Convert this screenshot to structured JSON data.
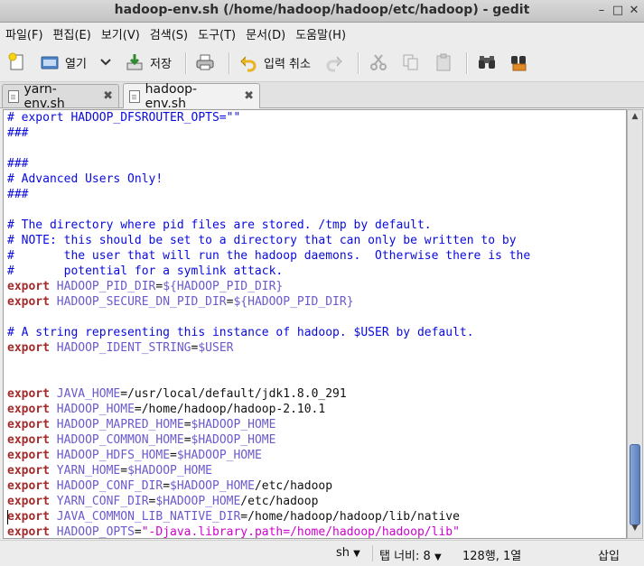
{
  "window": {
    "title": "hadoop-env.sh (/home/hadoop/hadoop/etc/hadoop) - gedit",
    "controls": {
      "minimize": "–",
      "maximize": "□",
      "close": "✕"
    }
  },
  "menu": {
    "items": [
      "파일(F)",
      "편집(E)",
      "보기(V)",
      "검색(S)",
      "도구(T)",
      "문서(D)",
      "도움말(H)"
    ]
  },
  "toolbar": {
    "open_label": "열기",
    "save_label": "저장",
    "undo_label": "입력 취소"
  },
  "tabs": [
    {
      "label": "yarn-env.sh",
      "close": "✖"
    },
    {
      "label": "hadoop-env.sh",
      "close": "✖"
    }
  ],
  "editor": {
    "lines": [
      [
        [
          "cm",
          "# export HADOOP_DFSROUTER_OPTS=\"\""
        ]
      ],
      [
        [
          "cm",
          "###"
        ]
      ],
      [
        [
          "tx",
          ""
        ]
      ],
      [
        [
          "cm",
          "###"
        ]
      ],
      [
        [
          "cm",
          "# Advanced Users Only!"
        ]
      ],
      [
        [
          "cm",
          "###"
        ]
      ],
      [
        [
          "tx",
          ""
        ]
      ],
      [
        [
          "cm",
          "# The directory where pid files are stored. /tmp by default."
        ]
      ],
      [
        [
          "cm",
          "# NOTE: this should be set to a directory that can only be written to by"
        ]
      ],
      [
        [
          "cm",
          "#       the user that will run the hadoop daemons.  Otherwise there is the"
        ]
      ],
      [
        [
          "cm",
          "#       potential for a symlink attack."
        ]
      ],
      [
        [
          "kw",
          "export"
        ],
        [
          "tx",
          " "
        ],
        [
          "vn",
          "HADOOP_PID_DIR"
        ],
        [
          "tx",
          "="
        ],
        [
          "vn",
          "${HADOOP_PID_DIR}"
        ]
      ],
      [
        [
          "kw",
          "export"
        ],
        [
          "tx",
          " "
        ],
        [
          "vn",
          "HADOOP_SECURE_DN_PID_DIR"
        ],
        [
          "tx",
          "="
        ],
        [
          "vn",
          "${HADOOP_PID_DIR}"
        ]
      ],
      [
        [
          "tx",
          ""
        ]
      ],
      [
        [
          "cm",
          "# A string representing this instance of hadoop. $USER by default."
        ]
      ],
      [
        [
          "kw",
          "export"
        ],
        [
          "tx",
          " "
        ],
        [
          "vn",
          "HADOOP_IDENT_STRING"
        ],
        [
          "tx",
          "="
        ],
        [
          "vn",
          "$USER"
        ]
      ],
      [
        [
          "tx",
          ""
        ]
      ],
      [
        [
          "tx",
          ""
        ]
      ],
      [
        [
          "kw",
          "export"
        ],
        [
          "tx",
          " "
        ],
        [
          "vn",
          "JAVA_HOME"
        ],
        [
          "tx",
          "=/usr/local/default/jdk1.8.0_291"
        ]
      ],
      [
        [
          "kw",
          "export"
        ],
        [
          "tx",
          " "
        ],
        [
          "vn",
          "HADOOP_HOME"
        ],
        [
          "tx",
          "=/home/hadoop/hadoop-2.10.1"
        ]
      ],
      [
        [
          "kw",
          "export"
        ],
        [
          "tx",
          " "
        ],
        [
          "vn",
          "HADOOP_MAPRED_HOME"
        ],
        [
          "tx",
          "="
        ],
        [
          "vn",
          "$HADOOP_HOME"
        ]
      ],
      [
        [
          "kw",
          "export"
        ],
        [
          "tx",
          " "
        ],
        [
          "vn",
          "HADOOP_COMMON_HOME"
        ],
        [
          "tx",
          "="
        ],
        [
          "vn",
          "$HADOOP_HOME"
        ]
      ],
      [
        [
          "kw",
          "export"
        ],
        [
          "tx",
          " "
        ],
        [
          "vn",
          "HADOOP_HDFS_HOME"
        ],
        [
          "tx",
          "="
        ],
        [
          "vn",
          "$HADOOP_HOME"
        ]
      ],
      [
        [
          "kw",
          "export"
        ],
        [
          "tx",
          " "
        ],
        [
          "vn",
          "YARN_HOME"
        ],
        [
          "tx",
          "="
        ],
        [
          "vn",
          "$HADOOP_HOME"
        ]
      ],
      [
        [
          "kw",
          "export"
        ],
        [
          "tx",
          " "
        ],
        [
          "vn",
          "HADOOP_CONF_DIR"
        ],
        [
          "tx",
          "="
        ],
        [
          "vn",
          "$HADOOP_HOME"
        ],
        [
          "tx",
          "/etc/hadoop"
        ]
      ],
      [
        [
          "kw",
          "export"
        ],
        [
          "tx",
          " "
        ],
        [
          "vn",
          "YARN_CONF_DIR"
        ],
        [
          "tx",
          "="
        ],
        [
          "vn",
          "$HADOOP_HOME"
        ],
        [
          "tx",
          "/etc/hadoop"
        ]
      ],
      [
        [
          "kw",
          "export"
        ],
        [
          "tx",
          " "
        ],
        [
          "vn",
          "JAVA_COMMON_LIB_NATIVE_DIR"
        ],
        [
          "tx",
          "=/home/hadoop/hadoop/lib/native"
        ]
      ],
      [
        [
          "kw",
          "export"
        ],
        [
          "tx",
          " "
        ],
        [
          "vn",
          "HADOOP_OPTS"
        ],
        [
          "tx",
          "="
        ],
        [
          "st",
          "\"-Djava.library.path=/home/hadoop/hadoop/lib\""
        ]
      ]
    ]
  },
  "statusbar": {
    "language": "sh",
    "tab_width": "탭 너비: 8",
    "position": "128행, 1열",
    "mode": "삽입"
  }
}
